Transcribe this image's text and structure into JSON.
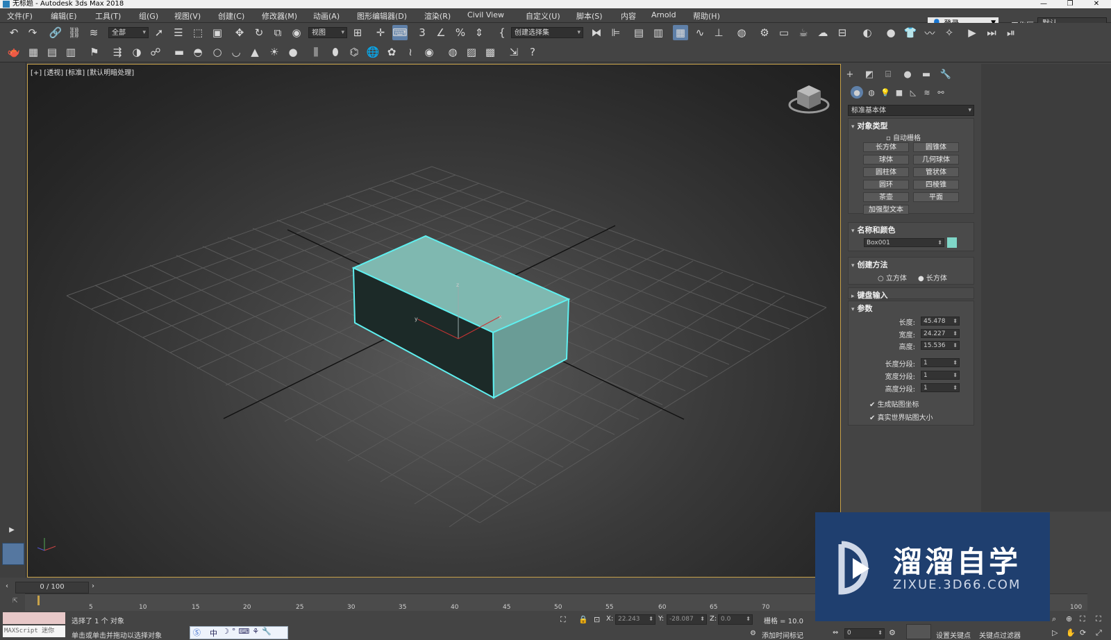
{
  "window": {
    "title": "无标题 - Autodesk 3ds Max 2018"
  },
  "menu": [
    "文件(F)",
    "编辑(E)",
    "工具(T)",
    "组(G)",
    "视图(V)",
    "创建(C)",
    "修改器(M)",
    "动画(A)",
    "图形编辑器(D)",
    "渲染(R)",
    "Civil View",
    "自定义(U)",
    "脚本(S)",
    "内容",
    "Arnold",
    "帮助(H)"
  ],
  "header": {
    "login": "登录",
    "workspace_label": "工作区:",
    "workspace_value": "默认"
  },
  "toolbar": {
    "selection_filter": "全部",
    "ref_coord": "视图",
    "selection_set": "创建选择集"
  },
  "viewport": {
    "label": "[+] [透视] [标准] [默认明暗处理]"
  },
  "command_panel": {
    "category": "标准基本体",
    "object_type": {
      "title": "对象类型",
      "autogrid": "自动栅格",
      "buttons": [
        "长方体",
        "圆锥体",
        "球体",
        "几何球体",
        "圆柱体",
        "管状体",
        "圆环",
        "四棱锥",
        "茶壶",
        "平面",
        "加强型文本"
      ]
    },
    "name_color": {
      "title": "名称和颜色",
      "name": "Box001",
      "color": "#7fd6c8"
    },
    "creation_method": {
      "title": "创建方法",
      "opt1": "立方体",
      "opt2": "长方体"
    },
    "keyboard_entry": {
      "title": "键盘输入"
    },
    "params": {
      "title": "参数",
      "rows": [
        {
          "label": "长度:",
          "value": "45.478"
        },
        {
          "label": "宽度:",
          "value": "24.227"
        },
        {
          "label": "高度:",
          "value": "15.536"
        },
        {
          "label": "长度分段:",
          "value": "1"
        },
        {
          "label": "宽度分段:",
          "value": "1"
        },
        {
          "label": "高度分段:",
          "value": "1"
        }
      ],
      "chk1": "生成贴图坐标",
      "chk2": "真实世界贴图大小"
    }
  },
  "timeline": {
    "frame": "0 / 100",
    "ticks": [
      "0",
      "5",
      "10",
      "15",
      "20",
      "25",
      "30",
      "35",
      "40",
      "45",
      "50",
      "55",
      "60",
      "65",
      "70",
      "100"
    ]
  },
  "status": {
    "script": "MAXScript 迷你",
    "selected": "选择了 1 个 对象",
    "prompt": "单击或单击并拖动以选择对象",
    "x_label": "X:",
    "x": "22.243",
    "y_label": "Y:",
    "y": "-28.087",
    "z_label": "Z:",
    "z": "0.0",
    "grid": "栅格 = 10.0",
    "add_time_tag": "添加时间标记",
    "spinner_value": "0",
    "set_key": "设置关键点",
    "key_filters": "关键点过滤器"
  },
  "ime": {
    "text": "中"
  },
  "watermark": {
    "title": "溜溜自学",
    "url": "ZIXUE.3D66.COM"
  }
}
